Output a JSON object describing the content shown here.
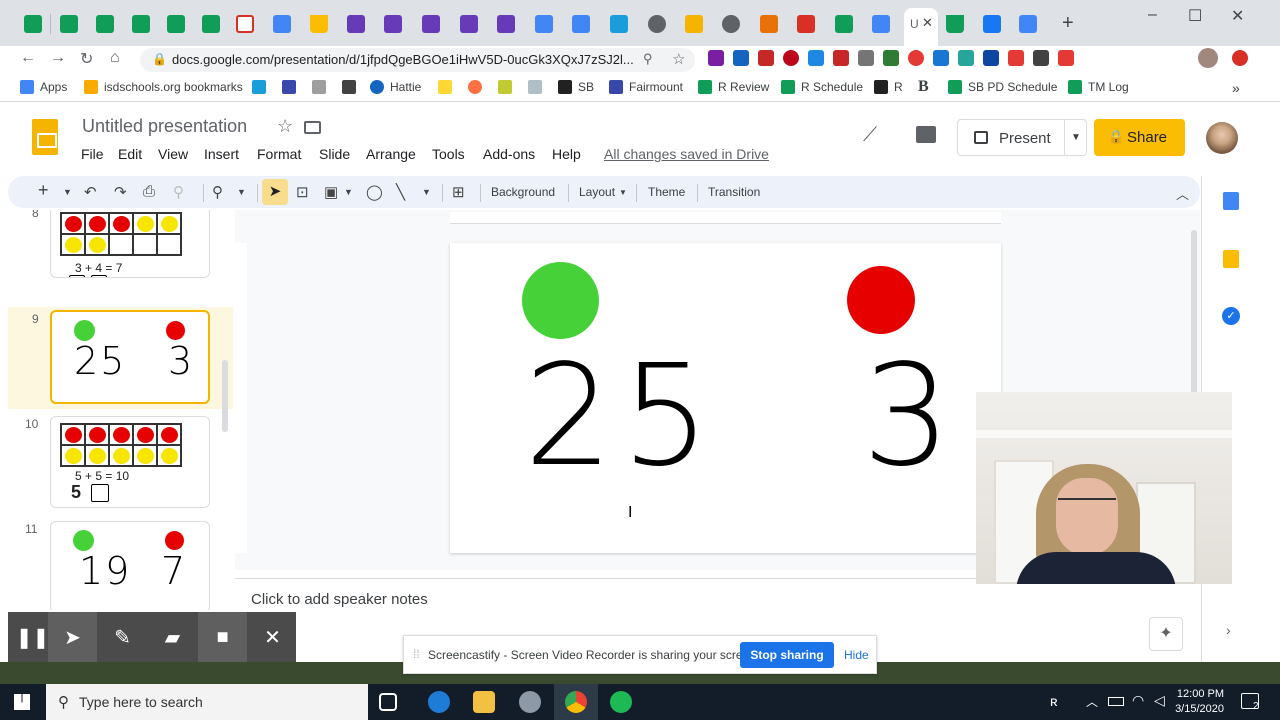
{
  "browser": {
    "url": "docs.google.com/presentation/d/1jfpdQgeBGOe1iHwV5D-0ucGk3XQxJ7zSJ2l...",
    "active_tab_label": "U",
    "bookmarks": [
      "Apps",
      "isdschools.org bookmarks",
      "Hattie",
      "SB",
      "Fairmount",
      "R Review",
      "R Schedule",
      "R",
      "SB PD Schedule",
      "TM Log"
    ]
  },
  "slides_app": {
    "title": "Untitled presentation",
    "menus": [
      "File",
      "Edit",
      "View",
      "Insert",
      "Format",
      "Slide",
      "Arrange",
      "Tools",
      "Add-ons",
      "Help"
    ],
    "saved_status": "All changes saved in Drive",
    "present_label": "Present",
    "share_label": "Share",
    "toolbar_text": [
      "Background",
      "Layout",
      "Theme",
      "Transition"
    ],
    "notes_placeholder": "Click to add speaker notes"
  },
  "filmstrip": {
    "slide8": {
      "number": "8",
      "equation": "3 + 4 = 7"
    },
    "slide9": {
      "number": "9",
      "left": "25",
      "right": "3"
    },
    "slide10": {
      "number": "10",
      "equation": "5 + 5 = 10",
      "count": "5"
    },
    "slide11": {
      "number": "11",
      "left": "19",
      "right": "7"
    }
  },
  "current_slide": {
    "left_number": "25",
    "right_number": "3",
    "left_dot_color": "#46d138",
    "right_dot_color": "#e60000"
  },
  "screencastify": {
    "message": "Screencastify - Screen Video Recorder is sharing your screen.",
    "stop_label": "Stop sharing",
    "hide_label": "Hide"
  },
  "taskbar": {
    "search_placeholder": "Type here to search",
    "time": "12:00 PM",
    "date": "3/15/2020",
    "notification_count": "2"
  },
  "colors": {
    "green": "#46d138",
    "red": "#e60000",
    "yellow": "#f7e600",
    "accent_blue": "#1a73e8",
    "share_yellow": "#fbbc04"
  }
}
